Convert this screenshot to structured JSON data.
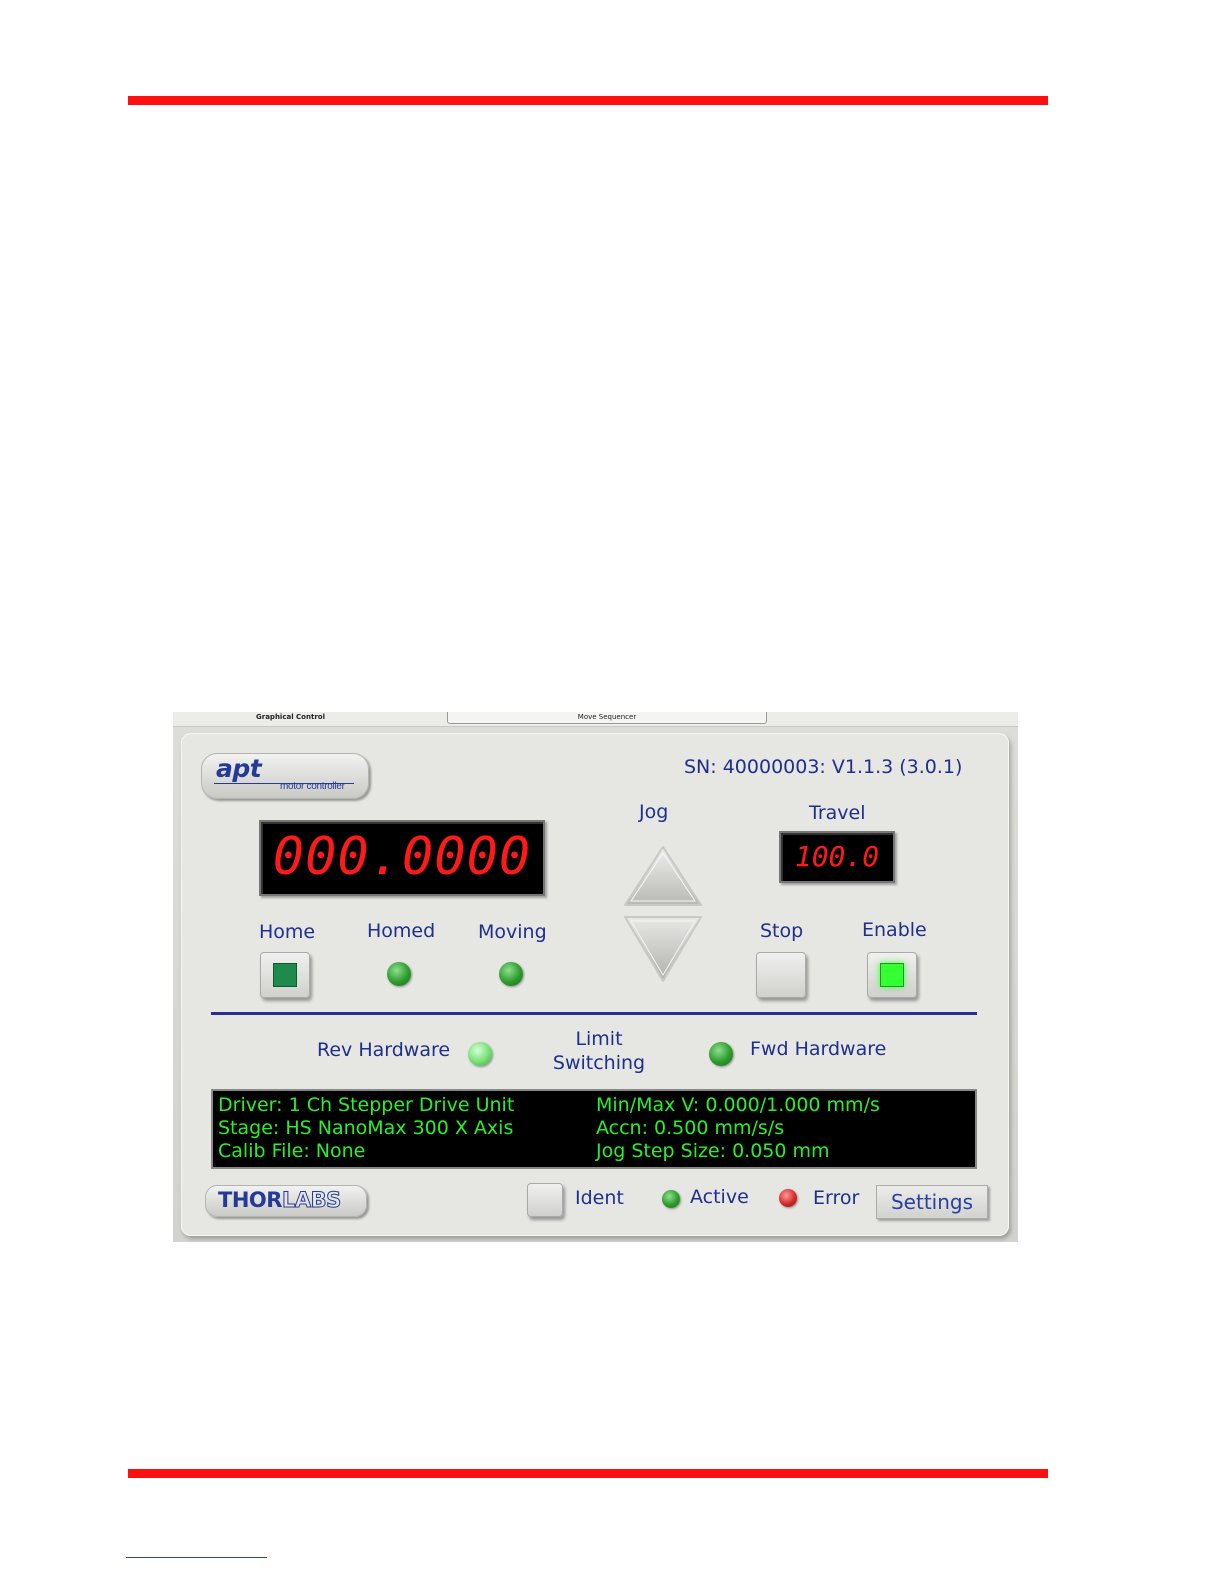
{
  "tabs": [
    {
      "label": "Graphical Control"
    },
    {
      "label": "Move Sequencer"
    }
  ],
  "header": {
    "logo_word": "apt",
    "logo_sub": "motor controller",
    "serial": "SN: 40000003: V1.1.3 (3.0.1)"
  },
  "position": {
    "value": "000.0000"
  },
  "jog": {
    "label": "Jog"
  },
  "travel": {
    "label": "Travel",
    "value": "100.0"
  },
  "controls": {
    "home": "Home",
    "homed": "Homed",
    "moving": "Moving",
    "stop": "Stop",
    "enable": "Enable"
  },
  "limits": {
    "rev": "Rev Hardware",
    "title_line1": "Limit",
    "title_line2": "Switching",
    "fwd": "Fwd Hardware"
  },
  "info": {
    "driver": "Driver: 1 Ch Stepper Drive Unit",
    "stage": "Stage:  HS NanoMax 300 X Axis",
    "calib": "Calib File: None",
    "minmax": "Min/Max V: 0.000/1.000 mm/s",
    "accn": "Accn: 0.500 mm/s/s",
    "jogstep": "Jog Step Size: 0.050 mm"
  },
  "footer": {
    "brand_a": "THOR",
    "brand_b": "LABS",
    "ident": "Ident",
    "active": "Active",
    "error": "Error",
    "settings": "Settings"
  },
  "colors": {
    "accent_red": "#ff1010",
    "label_blue": "#1e2f8c",
    "display_red": "#ff1a1a",
    "info_green": "#28f028"
  }
}
